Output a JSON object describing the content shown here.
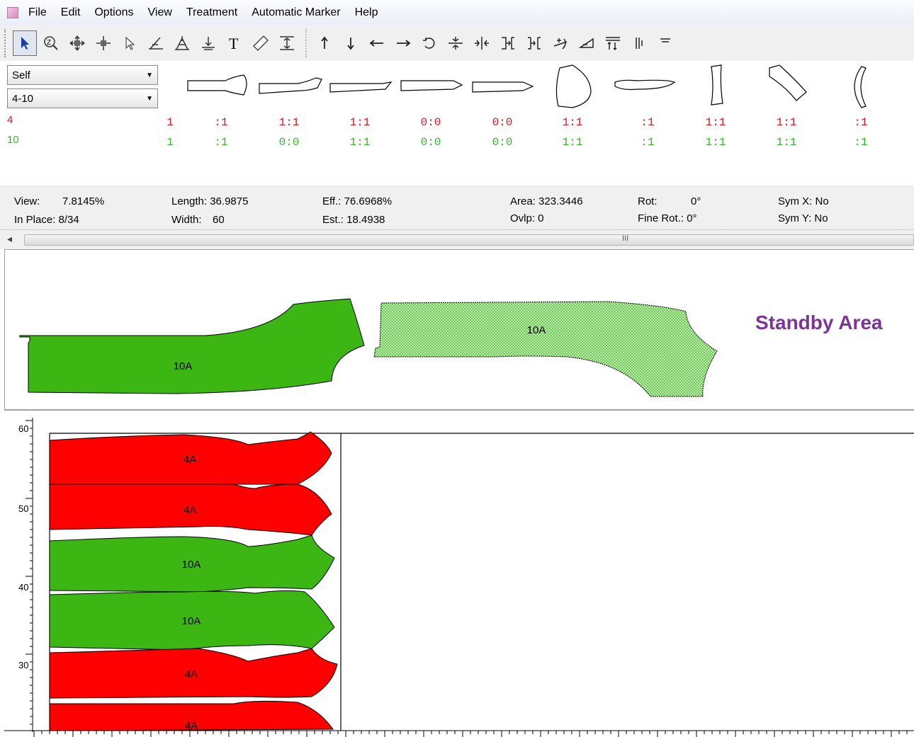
{
  "menu": [
    "File",
    "Edit",
    "Options",
    "View",
    "Treatment",
    "Automatic Marker",
    "Help"
  ],
  "toolbar": {
    "tools": [
      "select-tool",
      "zoom-tool",
      "move-all-tool",
      "move-piece-tool",
      "pointer-tool",
      "measure-angle-tool",
      "split-tool",
      "align-bottom-tool",
      "text-tool",
      "ruler-tool",
      "fit-tool"
    ],
    "moves": [
      "move-up",
      "move-down",
      "move-left",
      "move-right",
      "rotate",
      "flip-vertical",
      "flip-horizontal",
      "bump-right",
      "bump-left",
      "tilt-up",
      "tilt-down",
      "stack",
      "split-column",
      "options"
    ]
  },
  "fabric_select": "Self",
  "size_select": "4-10",
  "sizes": [
    {
      "label": "4",
      "color": "#e0121a"
    },
    {
      "label": "10",
      "color": "#35b52c"
    }
  ],
  "pieces": [
    {
      "top": "1",
      "bottom": "1"
    },
    {
      "top": ":1",
      "bottom": ":1"
    },
    {
      "top": "1:1",
      "bottom": "0:0"
    },
    {
      "top": "1:1",
      "bottom": "1:1"
    },
    {
      "top": "0:0",
      "bottom": "0:0"
    },
    {
      "top": "0:0",
      "bottom": "0:0"
    },
    {
      "top": "1:1",
      "bottom": "1:1"
    },
    {
      "top": ":1",
      "bottom": ":1"
    },
    {
      "top": "1:1",
      "bottom": "1:1"
    },
    {
      "top": "1:1",
      "bottom": "1:1"
    },
    {
      "top": ":1",
      "bottom": ":1"
    }
  ],
  "status": {
    "view_label": "View:",
    "view_value": "7.8145%",
    "in_place": "In Place: 8/34",
    "length": "Length: 36.9875",
    "width_label": "Width:",
    "width_value": "60",
    "eff": "Eff.: 76.6968%",
    "est": "Est.: 18.4938",
    "area": "Area: 323.3446",
    "ovlp": "Ovlp: 0",
    "rot_label": "Rot:",
    "rot_value": "0°",
    "fine_rot": "Fine Rot.: 0°",
    "sym_x": "Sym X: No",
    "sym_y": "Sym Y: No"
  },
  "scroll_grip": "III",
  "standby": {
    "label": "Standby Area",
    "pieces": [
      "10A",
      "10A"
    ]
  },
  "marker": {
    "ruler_labels": [
      "60",
      "50",
      "40",
      "30"
    ],
    "pieces": [
      "4A",
      "4A",
      "10A",
      "10A",
      "4A",
      "4A"
    ]
  },
  "colors": {
    "red_piece": "#ff0000",
    "green_piece": "#3cb612",
    "standby_purple": "#7a3596"
  }
}
